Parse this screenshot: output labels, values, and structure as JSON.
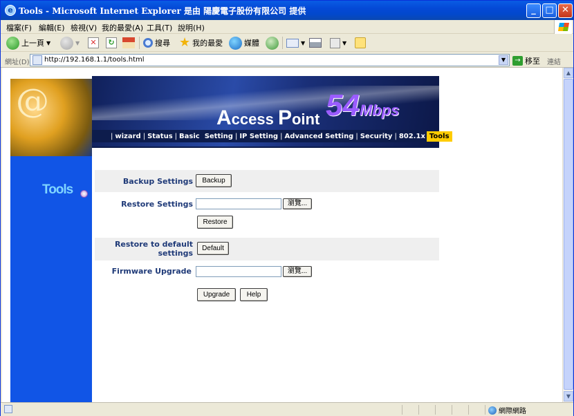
{
  "window": {
    "title": "Tools - Microsoft Internet Explorer 是由 陽慶電子股份有限公司 提供",
    "minimize": "_",
    "maximize": "□",
    "close": "✕"
  },
  "menu": [
    "檔案(F)",
    "編輯(E)",
    "檢視(V)",
    "我的最愛(A)",
    "工具(T)",
    "說明(H)"
  ],
  "toolbar": {
    "back": "上一頁",
    "search": "搜尋",
    "favorites": "我的最愛",
    "media": "媒體"
  },
  "address": {
    "label": "網址(D)",
    "url": "http://192.168.1.1/tools.html",
    "go": "移至",
    "links": "連結"
  },
  "banner": {
    "a": "A",
    "ccess": "ccess ",
    "p": "P",
    "oint": "oint",
    "speed": "54",
    "unit": "Mbps"
  },
  "nav": {
    "items": [
      "wizard",
      "Status",
      "Basic  Setting",
      "IP Setting",
      "Advanced Setting",
      "Security",
      "802.1x"
    ],
    "active": "Tools"
  },
  "sidebar": {
    "title": "Tools"
  },
  "form": {
    "backup_label": "Backup Settings",
    "backup_button": "Backup",
    "restore_label": "Restore Settings",
    "browse_button": "瀏覽...",
    "restore_button": "Restore",
    "default_label_1": "Restore to default",
    "default_label_2": "settings",
    "default_button": "Default",
    "firmware_label": "Firmware Upgrade",
    "upgrade_button": "Upgrade",
    "help_button": "Help"
  },
  "status": {
    "zone": "網際網路"
  }
}
